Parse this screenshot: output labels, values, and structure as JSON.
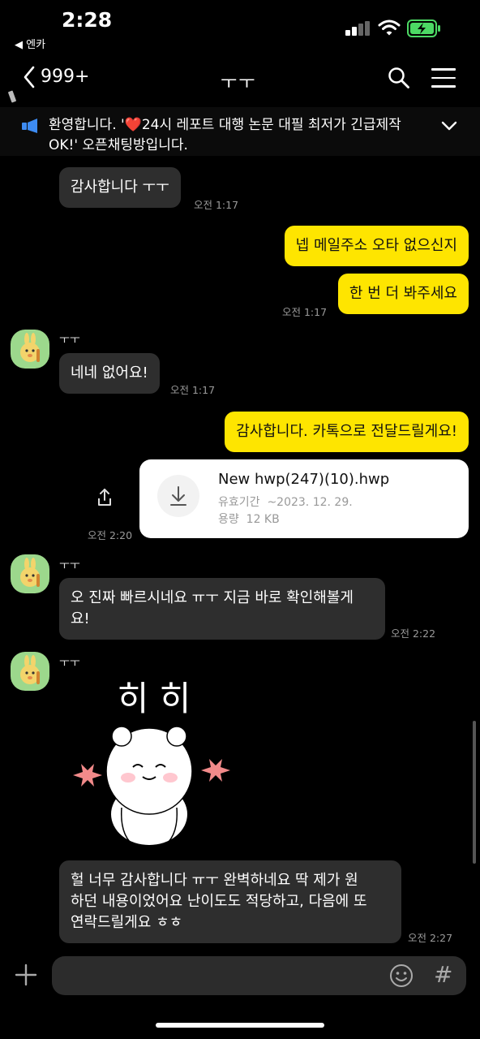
{
  "status_bar": {
    "time": "2:28",
    "back_app": "◀ 엔카",
    "icons": [
      "signal-icon",
      "wifi-icon",
      "battery-icon"
    ]
  },
  "header": {
    "unread_count": "999+",
    "title": "ㅜㅜ",
    "icons": [
      "back-icon",
      "search-icon",
      "menu-icon"
    ]
  },
  "notice": {
    "text": "환영합니다. '❤️24시 레포트 대행 논문 대필 최저가 긴급제작 OK!' 오픈채팅방입니다."
  },
  "messages": [
    {
      "side": "left",
      "text": "감사합니다 ㅜㅜ",
      "time": "오전 1:17"
    },
    {
      "side": "right",
      "text": "넵 메일주소 오타 없으신지"
    },
    {
      "side": "right",
      "text": "한 번 더 봐주세요",
      "time": "오전 1:17"
    },
    {
      "side": "left",
      "sender": "ㅜㅜ",
      "text": "네네 없어요!",
      "time": "오전 1:17"
    },
    {
      "side": "right",
      "text": "감사합니다. 카톡으로 전달드릴게요!"
    },
    {
      "side": "right",
      "type": "file",
      "file_name": "New hwp(247)(10).hwp",
      "expiry_label": "유효기간",
      "expiry_value": "~2023. 12. 29.",
      "size_label": "용량",
      "size_value": "12 KB",
      "time": "오전 2:20"
    },
    {
      "side": "left",
      "sender": "ㅜㅜ",
      "text_line1": "오 진짜 빠르시네요 ㅠㅜ 지금 바로 확인해볼게",
      "text_line2": "요!",
      "time": "오전 2:22"
    },
    {
      "side": "left",
      "sender": "ㅜㅜ",
      "type": "sticker",
      "sticker_text": "히 히"
    },
    {
      "side": "left",
      "text_line1": "헐 너무 감사합니다 ㅠㅜ 완벽하네요 딱 제가 원",
      "text_line2": "하던 내용이었어요 난이도도 적당하고, 다음에 또",
      "text_line3": "연락드릴게요 ㅎㅎ",
      "time": "오전 2:27"
    }
  ],
  "input_bar": {
    "hash_label": "#",
    "icons": [
      "plus-icon",
      "emoji-icon"
    ]
  },
  "colors": {
    "background": "#000000",
    "my_bubble": "#fee500",
    "their_bubble": "#2e2e2e",
    "avatar": "#9cd88c"
  }
}
